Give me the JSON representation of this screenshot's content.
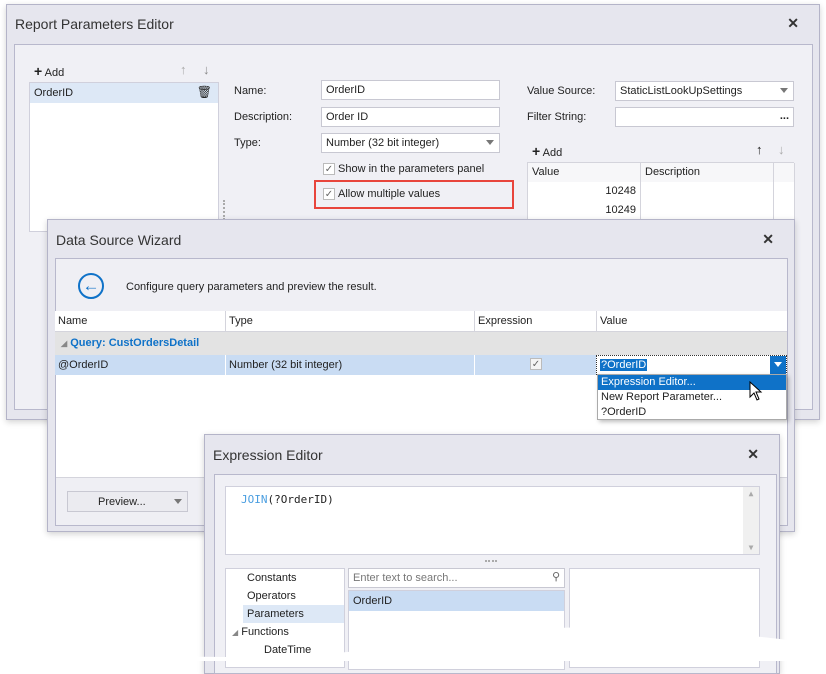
{
  "report_editor": {
    "title": "Report Parameters Editor",
    "add_label": "Add",
    "parameters": [
      "OrderID"
    ],
    "name_label": "Name:",
    "name_value": "OrderID",
    "description_label": "Description:",
    "description_value": "Order ID",
    "type_label": "Type:",
    "type_value": "Number (32 bit integer)",
    "show_in_panel_label": "Show in the parameters panel",
    "show_in_panel_checked": true,
    "allow_multiple_label": "Allow multiple values",
    "allow_multiple_checked": true,
    "value_source_label": "Value Source:",
    "value_source_value": "StaticListLookUpSettings",
    "filter_string_label": "Filter String:",
    "filter_string_value": "",
    "ellipsis": "...",
    "values_add_label": "Add",
    "grid_headers": [
      "Value",
      "Description"
    ],
    "grid_rows": [
      [
        "10248",
        ""
      ],
      [
        "10249",
        ""
      ]
    ],
    "highlight_color": "#e8453c"
  },
  "wizard": {
    "title": "Data Source Wizard",
    "instruction": "Configure query parameters and preview the result.",
    "headers": [
      "Name",
      "Type",
      "Expression",
      "Value"
    ],
    "group": "Query: CustOrdersDetail",
    "row": {
      "name": "@OrderID",
      "type": "Number (32 bit integer)",
      "expression": true,
      "value": "?OrderID"
    },
    "dropdown_items": [
      "Expression Editor...",
      "New Report Parameter...",
      "?OrderID"
    ],
    "preview_label": "Preview...",
    "accent": "#0f72c8"
  },
  "expr_editor": {
    "title": "Expression Editor",
    "func": "JOIN",
    "args": "(?OrderID)",
    "categories": [
      "Constants",
      "Operators",
      "Parameters",
      "Functions",
      "DateTime"
    ],
    "selected_category": "Parameters",
    "search_placeholder": "Enter text to search...",
    "items": [
      "OrderID"
    ]
  }
}
